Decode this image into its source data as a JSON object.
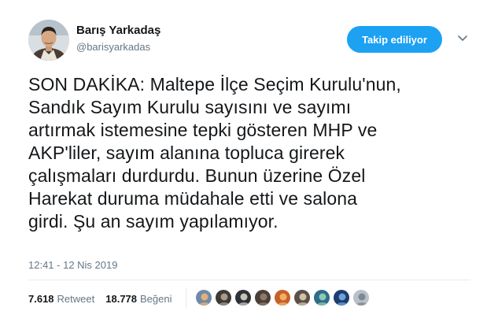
{
  "user": {
    "display_name": "Barış Yarkadaş",
    "handle": "@barisyarkadas"
  },
  "follow_button_label": "Takip ediliyor",
  "icons": {
    "more": "chevron-down-icon"
  },
  "tweet_text": "SON DAKİKA: Maltepe İlçe Seçim Kurulu'nun,\nSandık Sayım Kurulu sayısını ve sayımı\nartırmak istemesine tepki gösteren MHP ve\nAKP'liler, sayım alanına topluca girerek\nçalışmaları durdurdu. Bunun üzerine Özel\nHarekat duruma müdahale etti ve salona\ngirdi. Şu an sayım yapılamıyor.",
  "timestamp": "12:41 - 12 Nis 2019",
  "stats": {
    "retweets": {
      "count": "7.618",
      "label": "Retweet"
    },
    "likes": {
      "count": "18.778",
      "label": "Beğeni"
    }
  },
  "colors": {
    "accent": "#1da1f2",
    "secondary_text": "#657786",
    "primary_text": "#14171a"
  },
  "likers": [
    {
      "color": "#6f8aa8",
      "accent": "#e3b07a"
    },
    {
      "color": "#3d3a38",
      "accent": "#a89b8c"
    },
    {
      "color": "#2e3136",
      "accent": "#c9c2b8"
    },
    {
      "color": "#4a4038",
      "accent": "#8c7a68"
    },
    {
      "color": "#c8602c",
      "accent": "#f0b060"
    },
    {
      "color": "#5a5048",
      "accent": "#d2c0a8"
    },
    {
      "color": "#2f6b8a",
      "accent": "#8cc9b0"
    },
    {
      "color": "#1c3d6e",
      "accent": "#6fa0d8"
    },
    {
      "color": "#b8c0c8",
      "accent": "#7d8894"
    }
  ]
}
